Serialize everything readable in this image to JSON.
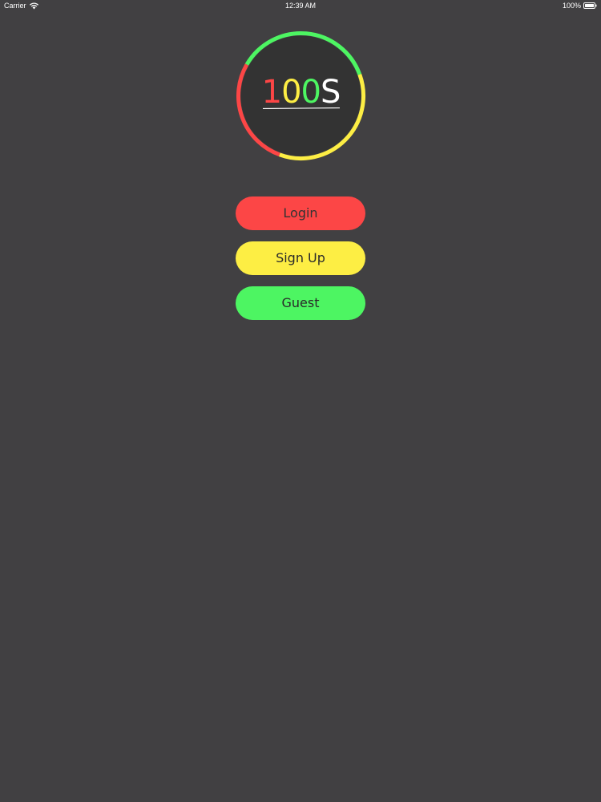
{
  "status_bar": {
    "carrier": "Carrier",
    "time": "12:39 AM",
    "battery": "100%",
    "wifi_icon": "wifi-icon",
    "battery_icon": "battery-icon"
  },
  "logo": {
    "digits": [
      "1",
      "0",
      "0"
    ],
    "letter": "S",
    "colors": {
      "red": "#fc4646",
      "yellow": "#fdee44",
      "green": "#4df562",
      "inner": "#333333",
      "white": "#ffffff"
    }
  },
  "buttons": {
    "login_label": "Login",
    "signup_label": "Sign Up",
    "guest_label": "Guest"
  },
  "colors": {
    "background": "#414042",
    "login": "#fc4646",
    "signup": "#fdee44",
    "guest": "#4df562"
  }
}
